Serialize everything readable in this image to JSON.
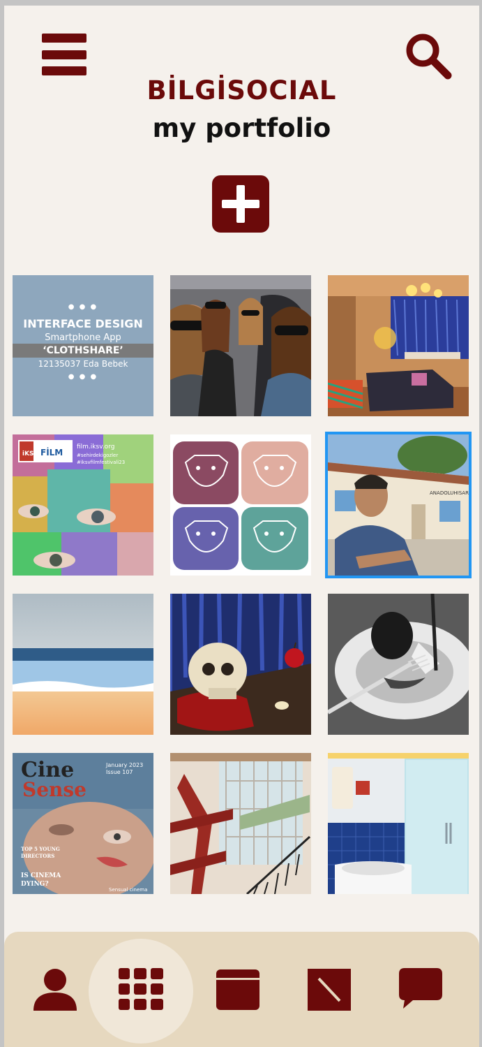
{
  "header": {
    "app_title": "BİLGİSOCIAL",
    "page_subtitle": "my portfolio",
    "menu_icon": "hamburger-menu-icon",
    "search_icon": "search-icon",
    "add_icon": "plus-icon"
  },
  "colors": {
    "accent": "#6b0a0a",
    "background": "#f5f1ec",
    "navbar": "#e6d8bf",
    "selection": "#2196f3"
  },
  "portfolio": {
    "items": [
      {
        "label": "Interface design smartphone app ClothShare",
        "lines": [
          "INTERFACE DESIGN",
          "Smartphone App",
          "‘CLOTHSHARE’",
          "12135037 Eda Bebek"
        ]
      },
      {
        "label": "Illustration of women with sunglasses in car"
      },
      {
        "label": "Illustration of living room interior"
      },
      {
        "label": "IKSV film festival poster",
        "lines": [
          "iKSV",
          "FİLM",
          "film.iksv.org",
          "#sehirdekigozler",
          "#iksvfilmfestivali23"
        ]
      },
      {
        "label": "Pug logo color variations"
      },
      {
        "label": "Portrait of man in front of Anadoluhisarı building",
        "lines": [
          "ANADOLUHISARI"
        ],
        "selected": true
      },
      {
        "label": "Abstract beach landscape"
      },
      {
        "label": "Still life skull and apple"
      },
      {
        "label": "Black and white plate with fork and knife"
      },
      {
        "label": "CineSense magazine cover",
        "lines": [
          "Cine",
          "Sense",
          "January 2023",
          "Issue 107",
          "TOP 5 YOUNG",
          "DIRECTORS",
          "IS CINEMA",
          "DYING?",
          "Sensual cinema"
        ]
      },
      {
        "label": "Industrial interior with red staircase"
      },
      {
        "label": "Bathroom interior illustration"
      }
    ]
  },
  "navbar": {
    "items": [
      {
        "icon": "profile-icon",
        "active": false
      },
      {
        "icon": "grid-icon",
        "active": true
      },
      {
        "icon": "calendar-icon",
        "active": false
      },
      {
        "icon": "edit-icon",
        "active": false
      },
      {
        "icon": "chat-bubble-icon",
        "active": false
      }
    ]
  }
}
